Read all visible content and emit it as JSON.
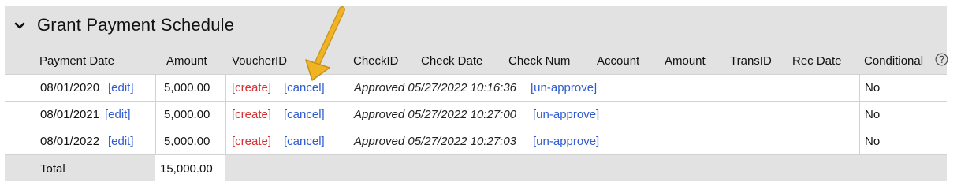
{
  "panel": {
    "title": "Grant Payment Schedule",
    "collapse_icon": "chevron-down-icon"
  },
  "headers": {
    "payment_date": "Payment Date",
    "amount": "Amount",
    "voucher_id": "VoucherID",
    "check_id": "CheckID",
    "check_date": "Check Date",
    "check_num": "Check Num",
    "account": "Account",
    "amount2": "Amount",
    "trans_id": "TransID",
    "rec_date": "Rec Date",
    "conditional": "Conditional",
    "help_icon": "question-circle-icon"
  },
  "rows": [
    {
      "date": "08/01/2020",
      "edit_label": "[edit]",
      "amount": "5,000.00",
      "create_label": "[create]",
      "cancel_label": "[cancel]",
      "status": "Approved 05/27/2022 10:16:36",
      "unapprove_label": "[un-approve]",
      "conditional": "No"
    },
    {
      "date": "08/01/2021",
      "edit_label": "[edit]",
      "amount": "5,000.00",
      "create_label": "[create]",
      "cancel_label": "[cancel]",
      "status": "Approved 05/27/2022 10:27:00",
      "unapprove_label": "[un-approve]",
      "conditional": "No"
    },
    {
      "date": "08/01/2022",
      "edit_label": "[edit]",
      "amount": "5,000.00",
      "create_label": "[create]",
      "cancel_label": "[cancel]",
      "status": "Approved 05/27/2022 10:27:03",
      "unapprove_label": "[un-approve]",
      "conditional": "No"
    }
  ],
  "total": {
    "label": "Total",
    "value": "15,000.00"
  },
  "colors": {
    "link": "#2f5bd0",
    "create_link": "#d63030",
    "panel_bg": "#e2e2e2",
    "annotation_arrow": "#f0b323"
  }
}
